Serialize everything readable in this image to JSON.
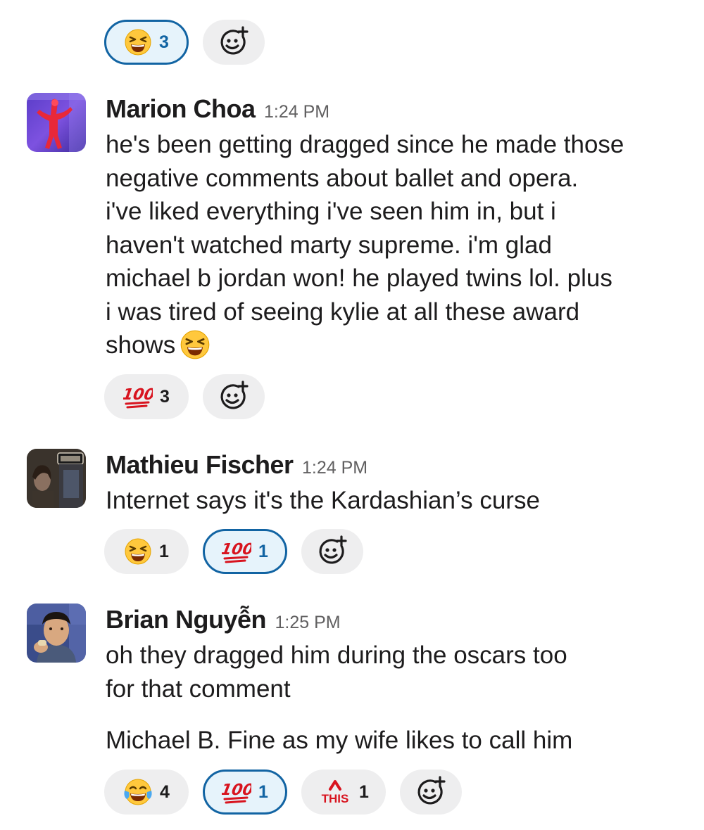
{
  "top_reactions": [
    {
      "emoji": "laughing-emoji",
      "count": "3",
      "mine": true
    }
  ],
  "messages": [
    {
      "author": "Marion Choa",
      "time": "1:24 PM",
      "lines": [
        "he's been getting dragged since he made those",
        "negative comments about ballet and opera.",
        "i've liked everything i've seen him in, but i",
        "haven't watched marty supreme. i'm glad",
        "michael b jordan won! he played twins lol. plus",
        "i was tired of seeing kylie at all these award",
        "shows"
      ],
      "inline_emoji": "laughing-emoji",
      "reactions": [
        {
          "emoji": "hundred-points-emoji",
          "count": "3",
          "mine": false
        }
      ]
    },
    {
      "author": "Mathieu Fischer",
      "time": "1:24 PM",
      "lines": [
        "Internet says it's the Kardashian’s curse"
      ],
      "reactions": [
        {
          "emoji": "laughing-emoji",
          "count": "1",
          "mine": false
        },
        {
          "emoji": "hundred-points-emoji",
          "count": "1",
          "mine": true
        }
      ]
    },
    {
      "author": "Brian Nguyễn",
      "time": "1:25 PM",
      "lines": [
        "oh they dragged him during the oscars too",
        "for that comment"
      ],
      "second_message": "Michael B. Fine as my wife likes to call him",
      "reactions": [
        {
          "emoji": "joy-emoji",
          "count": "4",
          "mine": false
        },
        {
          "emoji": "hundred-points-emoji",
          "count": "1",
          "mine": true
        },
        {
          "emoji": "this-emoji",
          "count": "1",
          "mine": false,
          "label": "THIS"
        }
      ]
    }
  ],
  "colors": {
    "accent": "#1264a3",
    "pill": "#eeeeef",
    "pill_selected": "#e6f3fb",
    "text": "#1d1c1d",
    "muted": "#616061"
  }
}
